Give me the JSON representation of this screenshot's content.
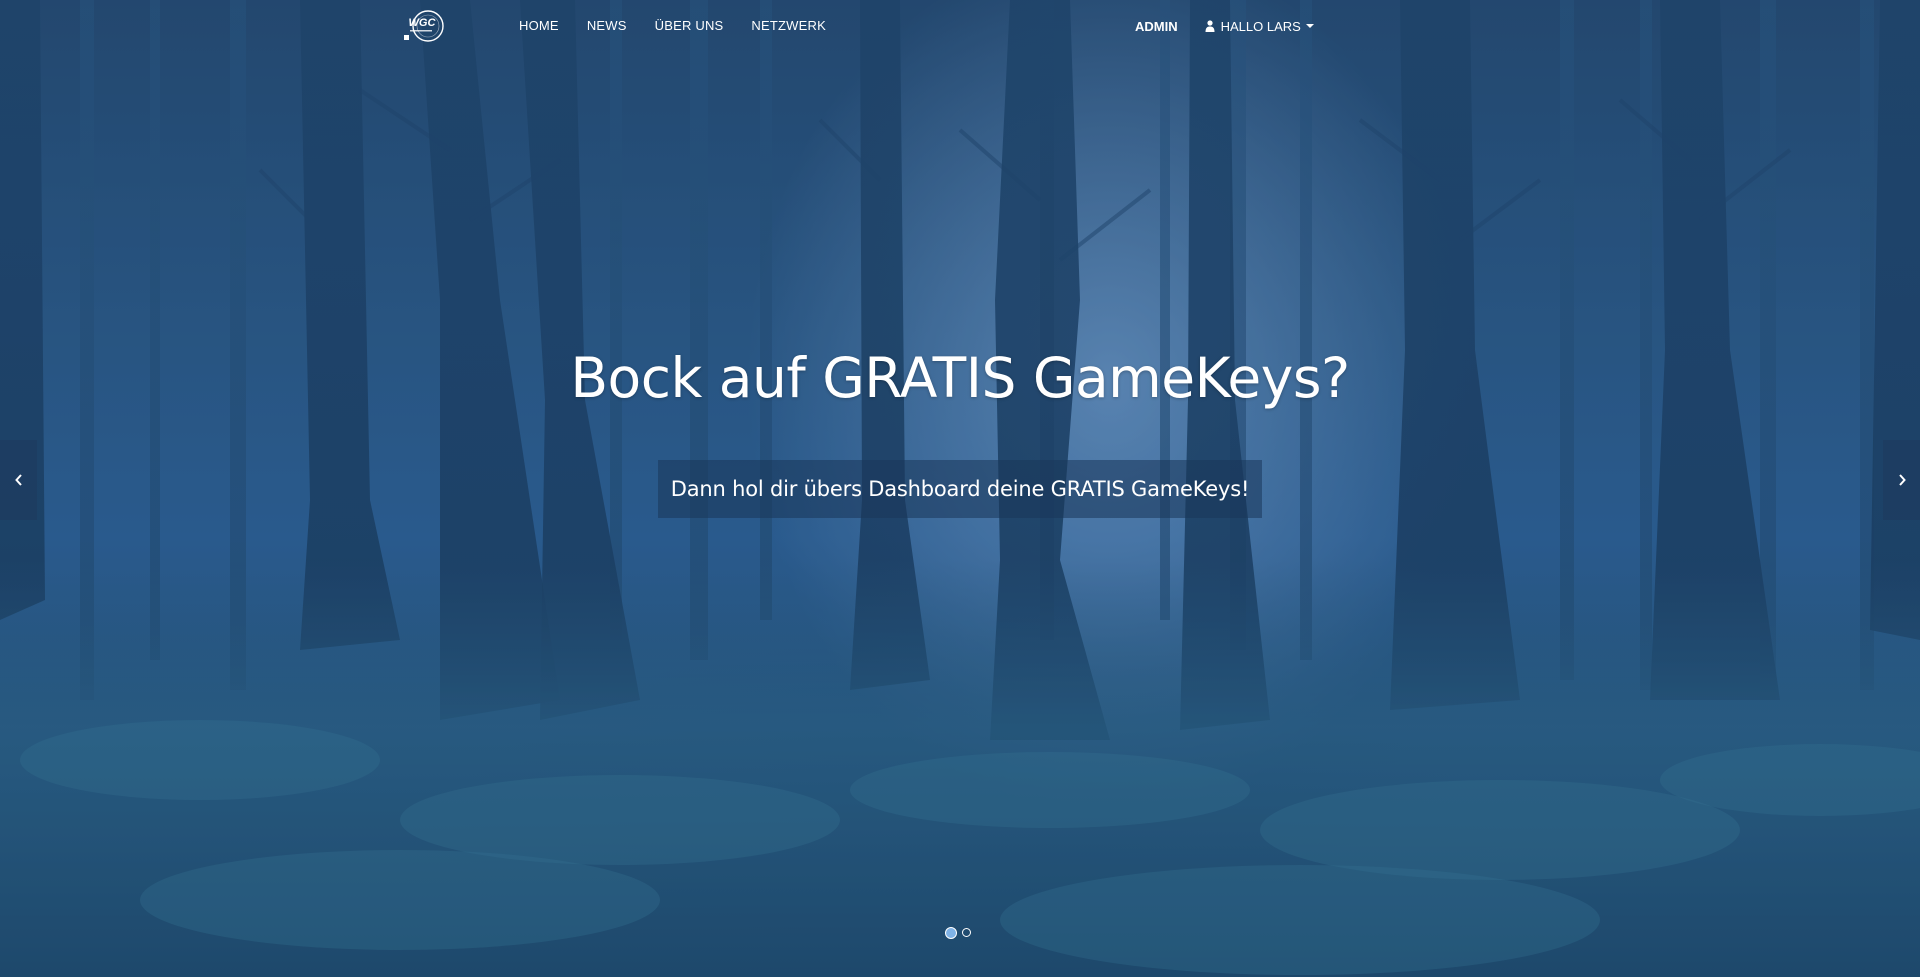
{
  "navbar": {
    "logo_text": "WGC",
    "links": [
      {
        "label": "HOME"
      },
      {
        "label": "NEWS"
      },
      {
        "label": "ÜBER UNS"
      },
      {
        "label": "NETZWERK"
      }
    ],
    "admin_label": "ADMIN",
    "user_label": "HALLO LARS",
    "user_icon": "user-icon",
    "caret_icon": "caret-down-icon"
  },
  "hero": {
    "title": "Bock auf GRATIS GameKeys?",
    "subtitle": "Dann hol dir übers Dashboard deine GRATIS GameKeys!"
  },
  "carousel": {
    "prev_icon": "chevron-left-icon",
    "next_icon": "chevron-right-icon",
    "slide_count": 2,
    "active_index": 0
  },
  "colors": {
    "accent": "#7fb2e6",
    "background": "#2b5986",
    "text": "#ffffff"
  }
}
